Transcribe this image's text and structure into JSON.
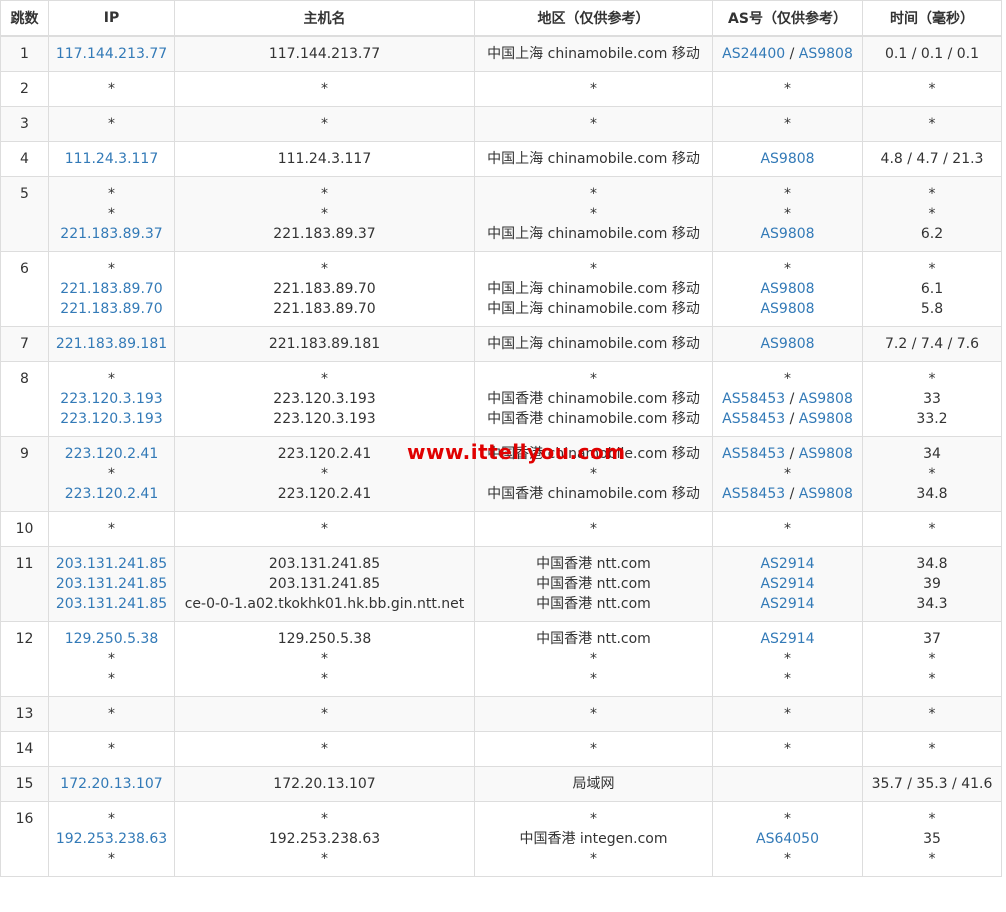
{
  "headers": [
    "跳数",
    "IP",
    "主机名",
    "地区（仅供参考）",
    "AS号（仅供参考）",
    "时间（毫秒）"
  ],
  "watermark": "www.ittellyou.com",
  "rows": [
    {
      "hop": "1",
      "ip": [
        "117.144.213.77"
      ],
      "host": [
        "117.144.213.77"
      ],
      "region": [
        "中国上海 chinamobile.com 移动"
      ],
      "as": [
        [
          "AS24400",
          "AS9808"
        ]
      ],
      "time": [
        "0.1 / 0.1 / 0.1"
      ]
    },
    {
      "hop": "2",
      "ip": [
        "*"
      ],
      "host": [
        "*"
      ],
      "region": [
        "*"
      ],
      "as": [
        [
          "*"
        ]
      ],
      "time": [
        "*"
      ]
    },
    {
      "hop": "3",
      "ip": [
        "*"
      ],
      "host": [
        "*"
      ],
      "region": [
        "*"
      ],
      "as": [
        [
          "*"
        ]
      ],
      "time": [
        "*"
      ]
    },
    {
      "hop": "4",
      "ip": [
        "111.24.3.117"
      ],
      "host": [
        "111.24.3.117"
      ],
      "region": [
        "中国上海 chinamobile.com 移动"
      ],
      "as": [
        [
          "AS9808"
        ]
      ],
      "time": [
        "4.8 / 4.7 / 21.3"
      ]
    },
    {
      "hop": "5",
      "ip": [
        "*",
        "*",
        "221.183.89.37"
      ],
      "host": [
        "*",
        "*",
        "221.183.89.37"
      ],
      "region": [
        "*",
        "*",
        "中国上海 chinamobile.com 移动"
      ],
      "as": [
        [
          "*"
        ],
        [
          "*"
        ],
        [
          "AS9808"
        ]
      ],
      "time": [
        "*",
        "*",
        "6.2"
      ]
    },
    {
      "hop": "6",
      "ip": [
        "*",
        "221.183.89.70",
        "221.183.89.70"
      ],
      "host": [
        "*",
        "221.183.89.70",
        "221.183.89.70"
      ],
      "region": [
        "*",
        "中国上海 chinamobile.com 移动",
        "中国上海 chinamobile.com 移动"
      ],
      "as": [
        [
          "*"
        ],
        [
          "AS9808"
        ],
        [
          "AS9808"
        ]
      ],
      "time": [
        "*",
        "6.1",
        "5.8"
      ]
    },
    {
      "hop": "7",
      "ip": [
        "221.183.89.181"
      ],
      "host": [
        "221.183.89.181"
      ],
      "region": [
        "中国上海 chinamobile.com 移动"
      ],
      "as": [
        [
          "AS9808"
        ]
      ],
      "time": [
        "7.2 / 7.4 / 7.6"
      ]
    },
    {
      "hop": "8",
      "ip": [
        "*",
        "223.120.3.193",
        "223.120.3.193"
      ],
      "host": [
        "*",
        "223.120.3.193",
        "223.120.3.193"
      ],
      "region": [
        "*",
        "中国香港 chinamobile.com 移动",
        "中国香港 chinamobile.com 移动"
      ],
      "as": [
        [
          "*"
        ],
        [
          "AS58453",
          "AS9808"
        ],
        [
          "AS58453",
          "AS9808"
        ]
      ],
      "time": [
        "*",
        "33",
        "33.2"
      ]
    },
    {
      "hop": "9",
      "ip": [
        "223.120.2.41",
        "*",
        "223.120.2.41"
      ],
      "host": [
        "223.120.2.41",
        "*",
        "223.120.2.41"
      ],
      "region": [
        "中国香港 chinamobile.com 移动",
        "*",
        "中国香港 chinamobile.com 移动"
      ],
      "as": [
        [
          "AS58453",
          "AS9808"
        ],
        [
          "*"
        ],
        [
          "AS58453",
          "AS9808"
        ]
      ],
      "time": [
        "34",
        "*",
        "34.8"
      ]
    },
    {
      "hop": "10",
      "ip": [
        "*"
      ],
      "host": [
        "*"
      ],
      "region": [
        "*"
      ],
      "as": [
        [
          "*"
        ]
      ],
      "time": [
        "*"
      ]
    },
    {
      "hop": "11",
      "ip": [
        "203.131.241.85",
        "203.131.241.85",
        "203.131.241.85"
      ],
      "host": [
        "203.131.241.85",
        "203.131.241.85",
        "ce-0-0-1.a02.tkokhk01.hk.bb.gin.ntt.net"
      ],
      "region": [
        "中国香港 ntt.com",
        "中国香港 ntt.com",
        "中国香港 ntt.com"
      ],
      "as": [
        [
          "AS2914"
        ],
        [
          "AS2914"
        ],
        [
          "AS2914"
        ]
      ],
      "time": [
        "34.8",
        "39",
        "34.3"
      ]
    },
    {
      "hop": "12",
      "ip": [
        "129.250.5.38",
        "*",
        "*"
      ],
      "host": [
        "129.250.5.38",
        "*",
        "*"
      ],
      "region": [
        "中国香港 ntt.com",
        "*",
        "*"
      ],
      "as": [
        [
          "AS2914"
        ],
        [
          "*"
        ],
        [
          "*"
        ]
      ],
      "time": [
        "37",
        "*",
        "*"
      ]
    },
    {
      "hop": "13",
      "ip": [
        "*"
      ],
      "host": [
        "*"
      ],
      "region": [
        "*"
      ],
      "as": [
        [
          "*"
        ]
      ],
      "time": [
        "*"
      ]
    },
    {
      "hop": "14",
      "ip": [
        "*"
      ],
      "host": [
        "*"
      ],
      "region": [
        "*"
      ],
      "as": [
        [
          "*"
        ]
      ],
      "time": [
        "*"
      ]
    },
    {
      "hop": "15",
      "ip": [
        "172.20.13.107"
      ],
      "host": [
        "172.20.13.107"
      ],
      "region": [
        "局域网"
      ],
      "as": [
        []
      ],
      "time": [
        "35.7 / 35.3 / 41.6"
      ]
    },
    {
      "hop": "16",
      "ip": [
        "*",
        "192.253.238.63",
        "*"
      ],
      "host": [
        "*",
        "192.253.238.63",
        "*"
      ],
      "region": [
        "*",
        "中国香港 integen.com",
        "*"
      ],
      "as": [
        [
          "*"
        ],
        [
          "AS64050"
        ],
        [
          "*"
        ]
      ],
      "time": [
        "*",
        "35",
        "*"
      ]
    }
  ]
}
